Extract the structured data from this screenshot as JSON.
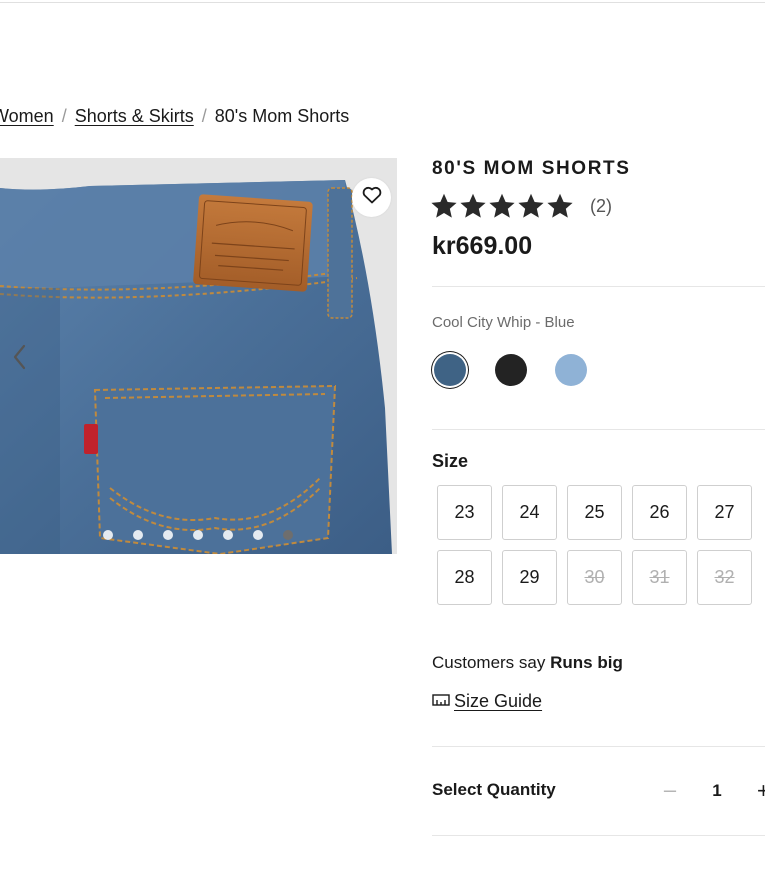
{
  "breadcrumb": {
    "items": [
      "Women",
      "Shorts & Skirts",
      "80's Mom Shorts"
    ]
  },
  "product": {
    "title": "80'S MOM SHORTS",
    "rating": 5,
    "review_count": "(2)",
    "price": "kr669.00",
    "color_name": "Cool City Whip - Blue",
    "swatches": [
      {
        "color": "#3f6385",
        "selected": true
      },
      {
        "color": "#232323",
        "selected": false
      },
      {
        "color": "#8fb2d6",
        "selected": false
      }
    ],
    "image_count": 7,
    "active_image_index": 6
  },
  "size": {
    "heading": "Size",
    "options": [
      {
        "label": "23",
        "available": true
      },
      {
        "label": "24",
        "available": true
      },
      {
        "label": "25",
        "available": true
      },
      {
        "label": "26",
        "available": true
      },
      {
        "label": "27",
        "available": true
      },
      {
        "label": "28",
        "available": true
      },
      {
        "label": "29",
        "available": true
      },
      {
        "label": "30",
        "available": false
      },
      {
        "label": "31",
        "available": false
      },
      {
        "label": "32",
        "available": false
      }
    ]
  },
  "fit": {
    "prefix": "Customers say",
    "value": "Runs big"
  },
  "size_guide": {
    "label": "Size Guide",
    "icon": "ruler-icon"
  },
  "quantity": {
    "label": "Select Quantity",
    "minus": "–",
    "value": "1",
    "plus": "+"
  },
  "icons": {
    "favorite": "heart-icon",
    "prev": "chevron-left-icon",
    "star": "star-icon"
  },
  "colors": {
    "text": "#1a1a1a",
    "muted": "#6b6b6b",
    "border": "#cfcfcf",
    "gallery_bg": "#e5e5e5"
  }
}
